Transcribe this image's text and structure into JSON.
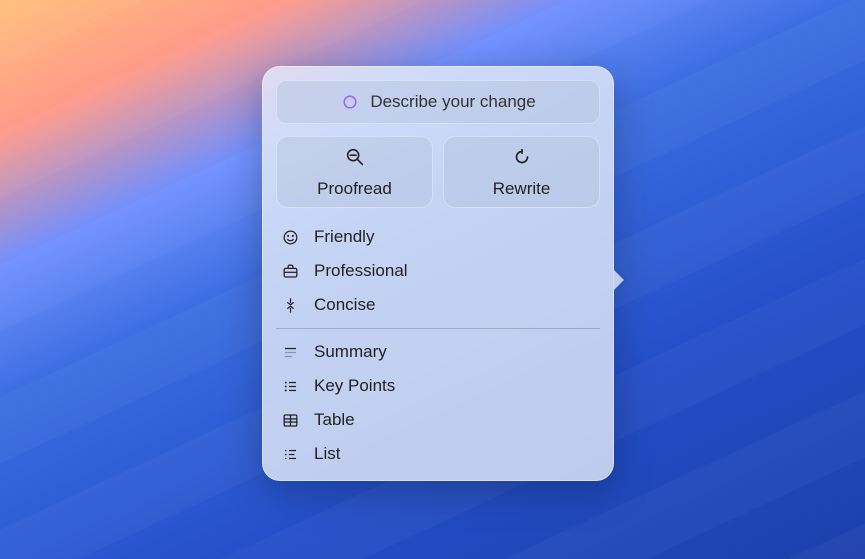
{
  "prompt": {
    "placeholder": "Describe your change"
  },
  "actions": {
    "proofread": "Proofread",
    "rewrite": "Rewrite"
  },
  "tones": [
    {
      "key": "friendly",
      "label": "Friendly"
    },
    {
      "key": "professional",
      "label": "Professional"
    },
    {
      "key": "concise",
      "label": "Concise"
    }
  ],
  "formats": [
    {
      "key": "summary",
      "label": "Summary"
    },
    {
      "key": "keypoints",
      "label": "Key Points"
    },
    {
      "key": "table",
      "label": "Table"
    },
    {
      "key": "list",
      "label": "List"
    }
  ]
}
